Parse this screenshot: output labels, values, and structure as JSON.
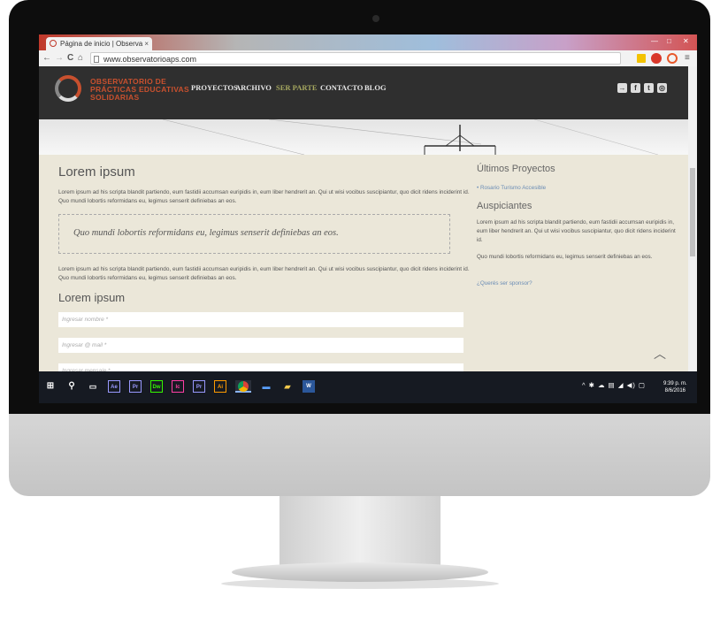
{
  "browser": {
    "tab_title": "Página de inicio | Observa",
    "tab_close": "×",
    "url": "www.observatorioaps.com",
    "nav": {
      "back": "←",
      "forward": "→",
      "reload": "C",
      "home": "⌂"
    },
    "window_controls": {
      "minimize": "—",
      "maximize": "□",
      "close": "✕"
    },
    "menu_icon": "≡"
  },
  "site": {
    "logo_lines": [
      {
        "text": "OBSERVATORIO DE",
        "color": "#c8502e"
      },
      {
        "text": "PRÁCTICAS EDUCATIVAS",
        "color": "#c8502e"
      },
      {
        "text": "SOLIDARIAS",
        "color": "#c8502e"
      }
    ],
    "nav": [
      {
        "label": "PROYECTOS",
        "active": false
      },
      {
        "label": "ARCHIVO",
        "active": false
      },
      {
        "label": "SER PARTE",
        "active": true
      },
      {
        "label": "CONTACTO",
        "active": false
      },
      {
        "label": "BLOG",
        "active": false
      }
    ],
    "social_icons": [
      "login-icon",
      "facebook-icon",
      "twitter-icon",
      "instagram-icon"
    ]
  },
  "main": {
    "heading": "Lorem ipsum",
    "paragraph1": "Lorem ipsum ad his scripta blandit partiendo, eum fastidii accumsan euripidis in, eum liber hendrerit an. Qui ut wisi vocibus suscipiantur, quo dicit ridens inciderint id. Quo mundi lobortis reformidans eu, legimus senserit definiebas an eos.",
    "quote": "Quo mundi lobortis reformidans eu, legimus senserit definiebas an eos.",
    "paragraph2": "Lorem ipsum ad his scripta blandit partiendo, eum fastidii accumsan euripidis in, eum liber hendrerit an. Qui ut wisi vocibus suscipiantur, quo dicit ridens inciderint id. Quo mundi lobortis reformidans eu, legimus senserit definiebas an eos.",
    "form_heading": "Lorem ipsum",
    "fields": {
      "name": "Ingresar nombre *",
      "email": "Ingresar @ mail *",
      "message": "Ingresar mensaje *"
    }
  },
  "sidebar": {
    "projects_heading": "Últimos Proyectos",
    "project_item": "Rosario Turismo Accesible",
    "sponsors_heading": "Auspiciantes",
    "sponsors_p1": "Lorem ipsum ad his scripta blandit partiendo, eum fastidii accumsan euripidis in, eum liber hendrerit an. Qui ut wisi vocibus suscipiantur, quo dicit ridens inciderint id.",
    "sponsors_p2": "Quo mundi lobortis reformidans eu, legimus senserit definiebas an eos.",
    "sponsor_link": "¿Querés ser sponsor?"
  },
  "taskbar": {
    "apps": [
      {
        "label": "Ae",
        "color": "#9999ff"
      },
      {
        "label": "Pr",
        "color": "#9999ff"
      },
      {
        "label": "Dw",
        "color": "#35fa00"
      },
      {
        "label": "Ic",
        "color": "#ff3fa5"
      },
      {
        "label": "Pr",
        "color": "#9999ff"
      },
      {
        "label": "Ai",
        "color": "#ff9a00"
      }
    ],
    "time": "9:39 p. m.",
    "date": "8/6/2016"
  }
}
